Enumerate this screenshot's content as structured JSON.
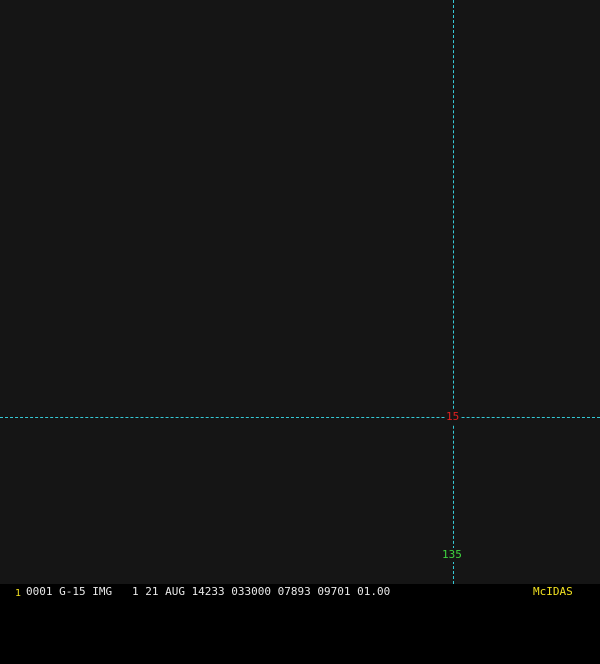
{
  "image": {
    "background_color": "#151515",
    "grid_color": "#35c9d6"
  },
  "grid": {
    "latitude_label": "15",
    "latitude_label_color": "#e02020",
    "longitude_label": "135",
    "longitude_label_color": "#3fd43f"
  },
  "status_bar": {
    "frame_number": "1",
    "text": "0001 G-15 IMG   1 21 AUG 14233 033000 07893 09701 01.00",
    "brand": "McIDAS",
    "accent_color": "#f0e020"
  }
}
